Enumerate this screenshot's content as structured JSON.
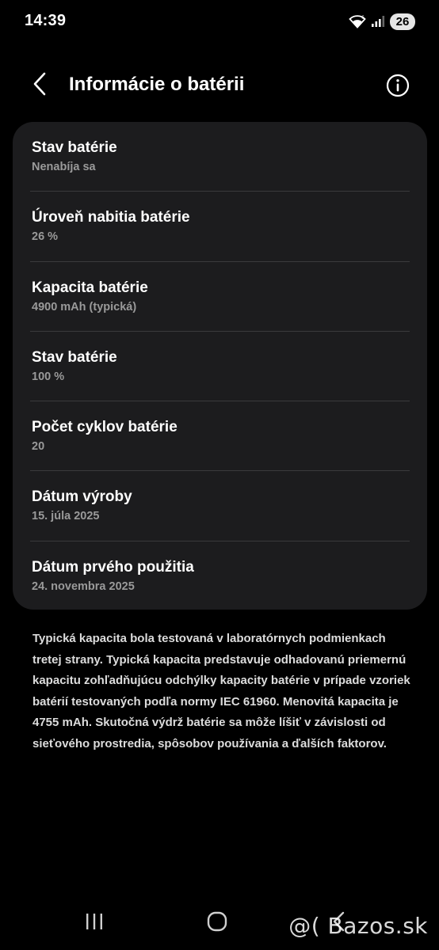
{
  "status_bar": {
    "time": "14:39",
    "wifi_icon": "wifi-icon",
    "signal_icon": "signal-icon",
    "battery_level": "26"
  },
  "header": {
    "back_icon": "chevron-left-icon",
    "title": "Informácie o batérii",
    "info_icon": "info-icon"
  },
  "battery_info": {
    "items": [
      {
        "title": "Stav batérie",
        "value": "Nenabíja sa"
      },
      {
        "title": "Úroveň nabitia batérie",
        "value": "26 %"
      },
      {
        "title": "Kapacita batérie",
        "value": "4900 mAh (typická)"
      },
      {
        "title": "Stav batérie",
        "value": "100 %"
      },
      {
        "title": "Počet cyklov batérie",
        "value": "20"
      },
      {
        "title": "Dátum výroby",
        "value": "15. júla 2025"
      },
      {
        "title": "Dátum prvého použitia",
        "value": "24. novembra 2025"
      }
    ]
  },
  "note": {
    "text": "Typická kapacita bola testovaná v laboratórnych podmienkach tretej strany. Typická kapacita predstavuje odhadovanú priemernú kapacitu zohľadňujúcu odchýlky kapacity batérie v prípade vzoriek batérií testovaných podľa normy IEC 61960. Menovitá kapacita je 4755 mAh. Skutočná výdrž batérie sa môže líšiť v závislosti od sieťového prostredia, spôsobov používania a ďalších faktorov."
  },
  "nav_bar": {
    "recents_icon": "recents-icon",
    "home_icon": "home-icon",
    "back_icon": "back-icon"
  },
  "watermark": "@( Bazos.sk",
  "colors": {
    "background": "#000000",
    "card": "#1c1c1e",
    "divider": "#3a3a3c",
    "secondary_text": "#9a9a9a",
    "note_text": "#dcdcdc"
  }
}
